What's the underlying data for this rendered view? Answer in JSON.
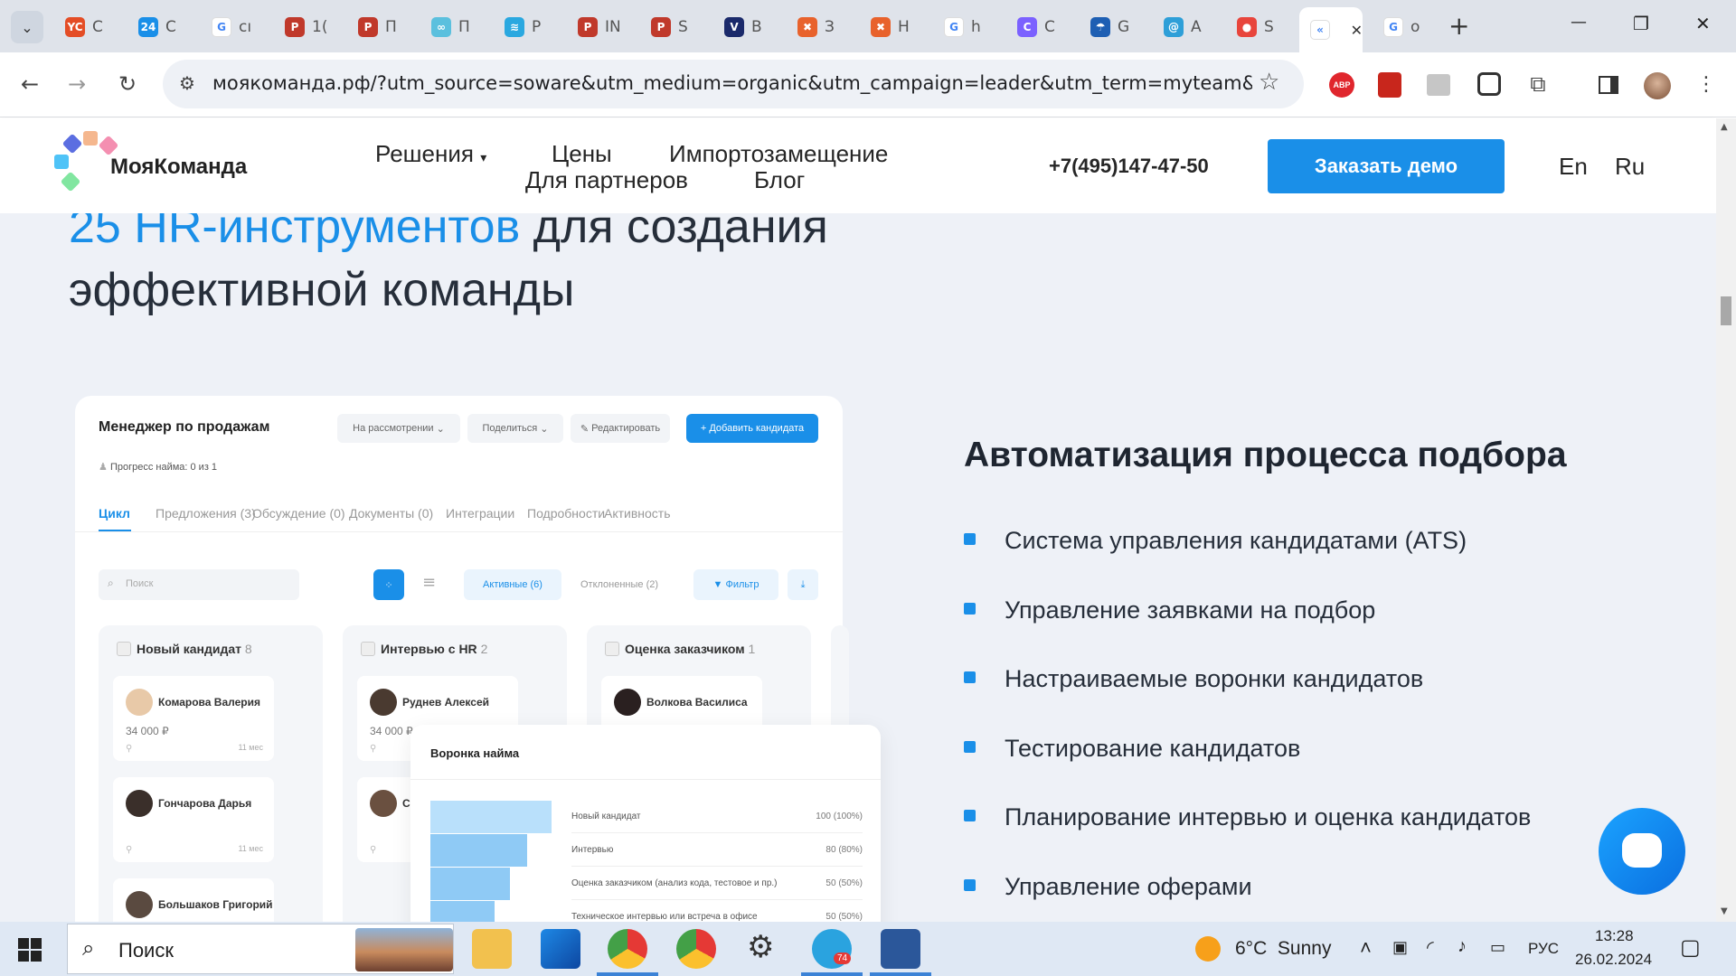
{
  "browser": {
    "tabs": [
      {
        "icon": "yc-icon",
        "label": "С",
        "color": "#e44d26",
        "glyph": "YC"
      },
      {
        "icon": "24-icon",
        "label": "С",
        "color": "#1a8fe8",
        "glyph": "24"
      },
      {
        "icon": "google-icon",
        "label": "cı",
        "color": "#ffffff",
        "glyph": "G"
      },
      {
        "icon": "pachca-icon",
        "label": "1(",
        "color": "#c0392b",
        "glyph": "P"
      },
      {
        "icon": "pachca-icon",
        "label": "П",
        "color": "#c0392b",
        "glyph": "P"
      },
      {
        "icon": "link-icon",
        "label": "П",
        "color": "#5bc0de",
        "glyph": "∞"
      },
      {
        "icon": "wave-icon",
        "label": "P",
        "color": "#2aa8e0",
        "glyph": "≋"
      },
      {
        "icon": "pachca-icon",
        "label": "IN",
        "color": "#c0392b",
        "glyph": "P"
      },
      {
        "icon": "pachca-icon",
        "label": "S",
        "color": "#c0392b",
        "glyph": "P"
      },
      {
        "icon": "v-icon",
        "label": "В",
        "color": "#1b2a6b",
        "glyph": "V"
      },
      {
        "icon": "x-orange-icon",
        "label": "З",
        "color": "#e8622c",
        "glyph": "✖"
      },
      {
        "icon": "x-orange-icon",
        "label": "Н",
        "color": "#e8622c",
        "glyph": "✖"
      },
      {
        "icon": "google-icon",
        "label": "h",
        "color": "#ffffff",
        "glyph": "G"
      },
      {
        "icon": "c-icon",
        "label": "С",
        "color": "#7b61ff",
        "glyph": "C"
      },
      {
        "icon": "umbrella-icon",
        "label": "G",
        "color": "#1e5fb3",
        "glyph": "☂"
      },
      {
        "icon": "swirl-icon",
        "label": "A",
        "color": "#2e9fd8",
        "glyph": "@"
      },
      {
        "icon": "circles-icon",
        "label": "S",
        "color": "#e8453c",
        "glyph": "●"
      },
      {
        "icon": "active-tab-icon",
        "label": "«",
        "color": "#ffffff",
        "glyph": "«",
        "active": true
      },
      {
        "icon": "google-icon",
        "label": "о",
        "color": "#ffffff",
        "glyph": "G"
      }
    ],
    "new_tab": "+",
    "window_controls": {
      "minimize": "—",
      "restore": "❐",
      "close": "✕"
    },
    "url": "моякоманда.рф/?utm_source=soware&utm_medium=organic&utm_campaign=leader&utm_term=myteam&utm_content...",
    "extensions": [
      "abp-icon",
      "pdf-icon",
      "reader-icon",
      "tab-copy-icon",
      "puzzle-icon",
      "sidebar-icon",
      "profile-avatar",
      "menu-icon"
    ],
    "abp_label": "ABP"
  },
  "site": {
    "logo_text": "МояКоманда",
    "nav": {
      "solutions": "Решения",
      "prices": "Цены",
      "import": "Импортозамещение",
      "partners": "Для партнеров",
      "blog": "Блог"
    },
    "phone": "+7(495)147-47-50",
    "cta": "Заказать демо",
    "lang_en": "En",
    "lang_ru": "Ru",
    "headline_blue": "25 HR-инструментов",
    "headline_rest": " для создания",
    "headline_line2": "эффективной команды"
  },
  "mock": {
    "job_title": "Менеджер по продажам",
    "status_select": "На рассмотрении",
    "share": "Поделиться",
    "edit": "Редактировать",
    "add_candidate": "Добавить кандидата",
    "progress": "Прогресс найма: 0 из 1",
    "tabs": [
      "Цикл",
      "Предложения (3)",
      "Обсуждение (0)",
      "Документы (0)",
      "Интеграции",
      "Подробности",
      "Активность"
    ],
    "search_placeholder": "Поиск",
    "active_filter": "Активные (6)",
    "rejected_filter": "Отклоненные (2)",
    "filter_btn": "Фильтр",
    "columns": [
      {
        "title": "Новый кандидат",
        "count": "8",
        "cards": [
          {
            "name": "Комарова Валерия",
            "salary": "34 000 ₽",
            "date": "11 мес"
          },
          {
            "name": "Гончарова Дарья",
            "salary": "",
            "date": "11 мес"
          },
          {
            "name": "Большаков Григорий",
            "salary": "",
            "date": "11 мес"
          }
        ]
      },
      {
        "title": "Интервью с HR",
        "count": "2",
        "cards": [
          {
            "name": "Руднев Алексей",
            "salary": "34 000 ₽",
            "date": ""
          },
          {
            "name": "С",
            "salary": "",
            "date": ""
          }
        ]
      },
      {
        "title": "Оценка заказчиком",
        "count": "1",
        "cards": [
          {
            "name": "Волкова Василиса",
            "salary": "",
            "date": ""
          }
        ]
      }
    ],
    "funnel": {
      "title": "Воронка найма",
      "rows": [
        {
          "label": "Новый кандидат",
          "value": "100 (100%)",
          "share": 1.0
        },
        {
          "label": "Интервью",
          "value": "80 (80%)",
          "share": 0.8
        },
        {
          "label": "Оценка заказчиком (анализ кода, тестовое и пр.)",
          "value": "50 (50%)",
          "share": 0.66
        },
        {
          "label": "Техническое интервью или встреча в офисе",
          "value": "50 (50%)",
          "share": 0.53
        }
      ]
    }
  },
  "features": {
    "title": "Автоматизация процесса подбора",
    "items": [
      "Система управления кандидатами (ATS)",
      "Управление заявками на подбор",
      "Настраиваемые воронки кандидатов",
      "Тестирование кандидатов",
      "Планирование интервью и оценка кандидатов",
      "Управление оферами"
    ]
  },
  "taskbar": {
    "search_label": "Поиск",
    "weather_temp": "6°C",
    "weather_desc": "Sunny",
    "lang": "РУС",
    "time": "13:28",
    "date": "26.02.2024",
    "telegram_badge": "74"
  }
}
